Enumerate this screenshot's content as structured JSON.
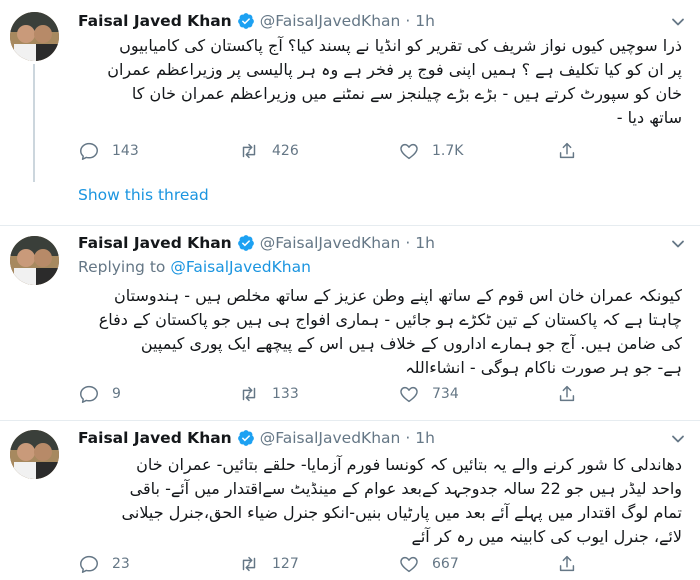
{
  "tweets": [
    {
      "name": "Faisal Javed Khan",
      "handle": "@FaisalJavedKhan",
      "separator": "·",
      "time": "1h",
      "replying_to": "",
      "lines": [
        "ذرا سوچیں کیوں نواز شریف کی تقریر کو انڈیا نے پسند کیا؟ آج پاکستان کی کامیابیوں",
        "پر ان کو کیا تکلیف ہے ؟ ہمیں اپنی فوج پر فخر ہے وہ ہر پالیسی پر وزیراعظم عمران",
        "خان کو سپورٹ کرتے ہیں - بڑے بڑے چیلنجز سے نمٹنے میں وزیراعظم عمران خان کا",
        "ساتھ دیا -"
      ],
      "replies": "143",
      "retweets": "426",
      "likes": "1.7K"
    },
    {
      "name": "Faisal Javed Khan",
      "handle": "@FaisalJavedKhan",
      "separator": "·",
      "time": "1h",
      "replying_label": "Replying to",
      "replying_to": "@FaisalJavedKhan",
      "lines": [
        "کیونکہ عمران خان اس قوم کے ساتھ اپنے وطن عزیز کے ساتھ مخلص ہیں - ہندوستان",
        "چاہتا ہے کہ پاکستان کے تین ٹکڑے ہو جائیں - ہماری افواج ہی ہیں جو پاکستان کے دفاع",
        "کی ضامن ہیں. آج جو ہمارے اداروں کے خلاف    ہیں اس کے پیچھے ایک پوری کیمپین",
        "ہے- جو ہر صورت ناکام ہوگی - انشاءاللہ"
      ],
      "replies": "9",
      "retweets": "133",
      "likes": "734"
    },
    {
      "name": "Faisal Javed Khan",
      "handle": "@FaisalJavedKhan",
      "separator": "·",
      "time": "1h",
      "replying_to": "",
      "lines": [
        "دھاندلی کا شور کرنے والے یہ بتائیں کہ کونسا فورم آزمایا- حلقے بتائیں- عمران خان",
        "واحد لیڈر ہیں جو 22 سالہ جدوجہد کےبعد عوام کے مینڈیٹ سےاقتدار میں آئے- باقی",
        "تمام لوگ اقتدار میں پہلے آئے بعد میں پارٹیاں بنیں-انکو جنرل ضیاء الحق،جنرل جیلانی",
        "لائے، جنرل ایوب کی کابینہ میں رہ کر آئے"
      ],
      "replies": "23",
      "retweets": "127",
      "likes": "667"
    }
  ],
  "show_thread": "Show this thread",
  "colors": {
    "accent": "#1b95e0",
    "muted": "#657786",
    "text": "#14171a",
    "divider": "#e6ecf0"
  },
  "icons": [
    "verified-badge-icon",
    "chevron-down-icon",
    "reply-icon",
    "retweet-icon",
    "like-icon",
    "share-icon"
  ]
}
